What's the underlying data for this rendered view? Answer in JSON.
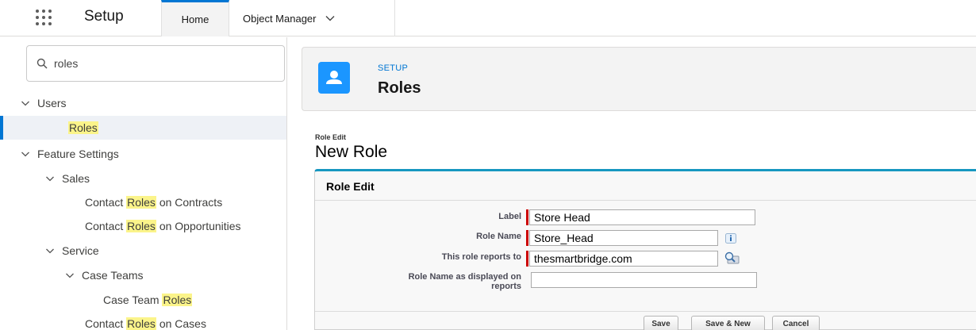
{
  "topbar": {
    "app_name": "Setup",
    "tabs": [
      {
        "label": "Home"
      },
      {
        "label": "Object Manager"
      }
    ]
  },
  "sidebar": {
    "search_value": "roles",
    "tree": [
      {
        "id": "users",
        "prefix": "",
        "match": "",
        "suffix": "Users",
        "expanded": true
      },
      {
        "id": "roles",
        "prefix": "",
        "match": "Roles",
        "suffix": "",
        "selected": true
      },
      {
        "id": "feature-settings",
        "prefix": "",
        "match": "",
        "suffix": "Feature Settings",
        "expanded": true
      },
      {
        "id": "sales",
        "prefix": "",
        "match": "",
        "suffix": "Sales",
        "expanded": true
      },
      {
        "id": "contact-roles-contracts",
        "prefix": "Contact ",
        "match": "Roles",
        "suffix": " on Contracts"
      },
      {
        "id": "contact-roles-opportunities",
        "prefix": "Contact ",
        "match": "Roles",
        "suffix": " on Opportunities"
      },
      {
        "id": "service",
        "prefix": "",
        "match": "",
        "suffix": "Service",
        "expanded": true
      },
      {
        "id": "case-teams",
        "prefix": "",
        "match": "",
        "suffix": "Case Teams",
        "expanded": true
      },
      {
        "id": "case-team-roles",
        "prefix": "Case Team ",
        "match": "Roles",
        "suffix": ""
      },
      {
        "id": "contact-roles-cases",
        "prefix": "Contact ",
        "match": "Roles",
        "suffix": " on Cases"
      }
    ]
  },
  "header": {
    "kicker": "SETUP",
    "title": "Roles"
  },
  "page": {
    "subtitle": "Role Edit",
    "title": "New Role"
  },
  "form": {
    "section_title": "Role Edit",
    "fields": {
      "label": {
        "label": "Label",
        "value": "Store Head"
      },
      "role_name": {
        "label": "Role Name",
        "value": "Store_Head"
      },
      "reports_to": {
        "label": "This role reports to",
        "value": "thesmartbridge.com"
      },
      "display_name": {
        "label_line1": "Role Name as displayed on",
        "label_line2": "reports",
        "value": ""
      }
    },
    "buttons": {
      "save": "Save",
      "save_new": "Save & New",
      "cancel": "Cancel"
    }
  },
  "colors": {
    "brand_blue": "#0176d3",
    "icon_blue": "#1b96ff",
    "panel_border": "#1797c0",
    "required_red": "#cc0000",
    "highlight": "#fbf48a"
  }
}
